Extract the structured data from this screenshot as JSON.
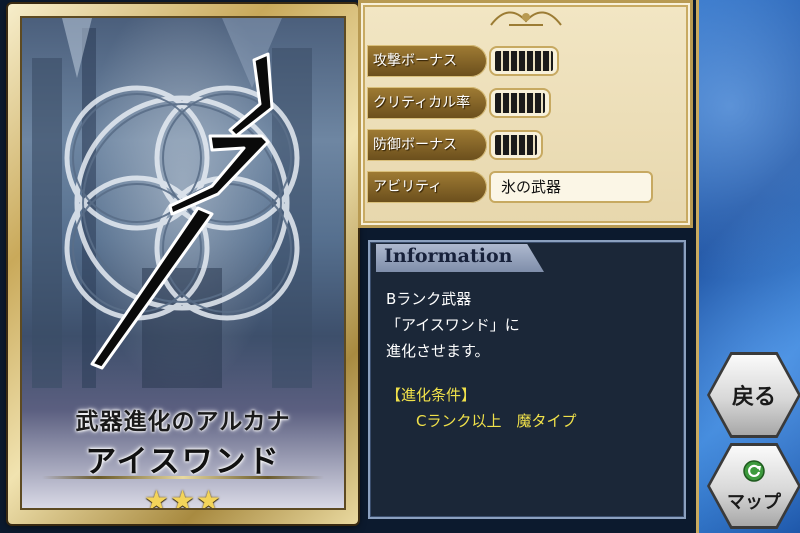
{
  "card": {
    "title": "武器進化のアルカナ",
    "name": "アイスワンド",
    "stars": "★★★"
  },
  "stats": {
    "rows": [
      {
        "label": "攻撃ボーナス",
        "bar_segments": 7
      },
      {
        "label": "クリティカル率",
        "bar_segments": 6
      },
      {
        "label": "防御ボーナス",
        "bar_segments": 5
      }
    ],
    "ability": {
      "label": "アビリティ",
      "value": "氷の武器"
    }
  },
  "information": {
    "title": "Information",
    "lines": [
      "Bランク武器",
      "「アイスワンド」に",
      "進化させます。"
    ],
    "condition_heading": "【進化条件】",
    "condition_text": "Cランク以上　魔タイプ"
  },
  "nav": {
    "back_label": "戻る",
    "map_label": "マップ"
  },
  "colors": {
    "gold": "#c9aa60",
    "info_bg": "#1b2738",
    "condition_yellow": "#f0e14a"
  }
}
